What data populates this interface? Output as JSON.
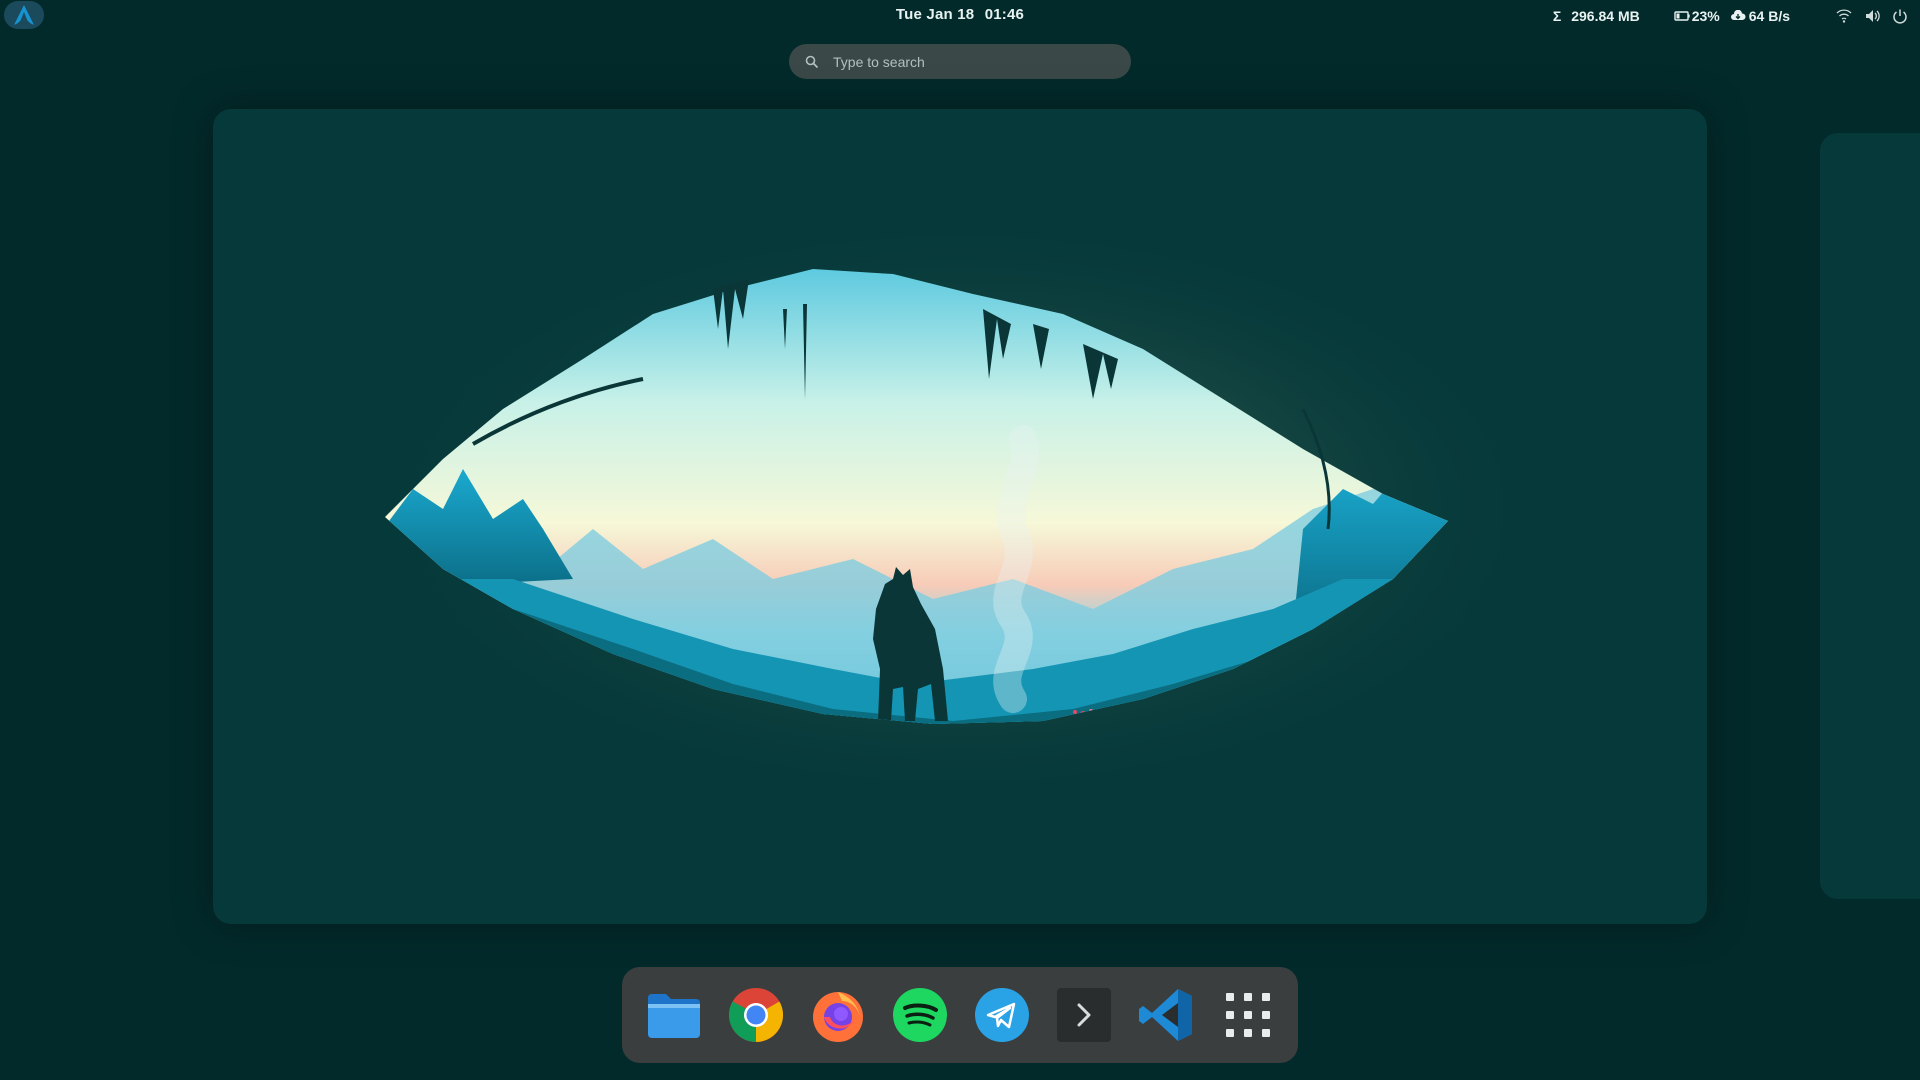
{
  "topbar": {
    "activities_icon": "arch-linux-logo-icon",
    "clock": {
      "date": "Tue Jan 18",
      "time": "01:46"
    },
    "indicators": {
      "memory_symbol": "Σ",
      "memory": "296.84 MB",
      "battery": "23%",
      "network_speed": "64 B/s",
      "icons": [
        "wifi-icon",
        "volume-icon",
        "power-icon"
      ]
    }
  },
  "search": {
    "placeholder": "Type to search"
  },
  "dock": {
    "apps": [
      {
        "name": "files-app-icon"
      },
      {
        "name": "chrome-app-icon"
      },
      {
        "name": "firefox-app-icon"
      },
      {
        "name": "spotify-app-icon"
      },
      {
        "name": "telegram-app-icon"
      },
      {
        "name": "terminal-app-icon"
      },
      {
        "name": "vscode-app-icon"
      },
      {
        "name": "show-apps-grid-icon"
      }
    ]
  },
  "colors": {
    "background": "#032a2b",
    "workspace": "#06393a",
    "dock": "#3a3e3f",
    "search": "#3a4848",
    "sky_top": "#56c7df",
    "sky_glow": "#f6f8d8"
  }
}
